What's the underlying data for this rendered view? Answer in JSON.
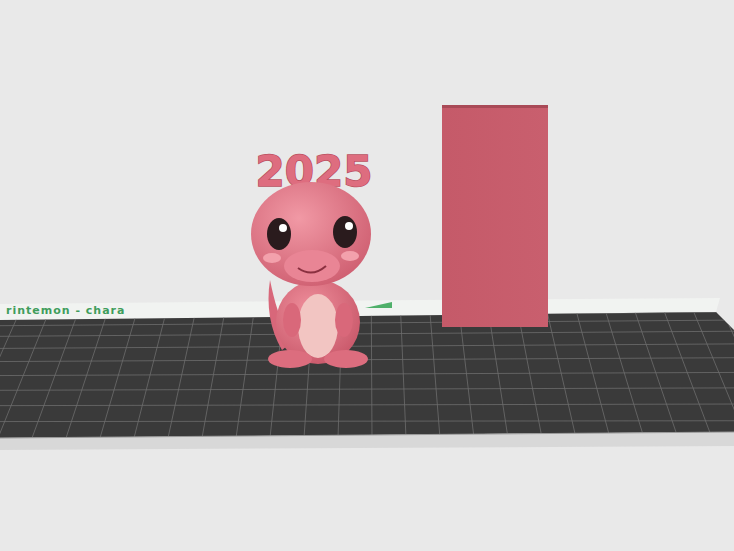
{
  "viewport": {
    "bed": {
      "label": "rintemon - chara"
    },
    "model": {
      "text": "2025"
    }
  }
}
